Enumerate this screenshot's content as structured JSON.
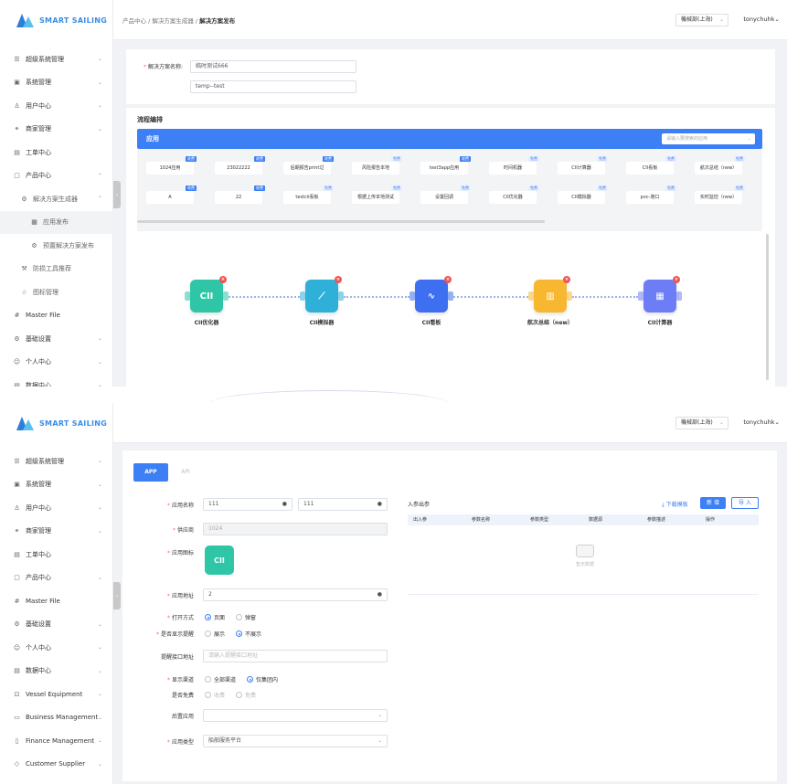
{
  "brand": {
    "logo_text": "SMART SAILING"
  },
  "shot1": {
    "breadcrumb": {
      "part1": "产品中心",
      "part2": "解决方案生成器",
      "current": "解决方案发布"
    },
    "header": {
      "dept": "機械部(上海)",
      "user": "tonychuhk"
    },
    "menu": [
      {
        "label": "超级系统管理",
        "icon": "list-icon",
        "chev": "⌄"
      },
      {
        "label": "系统管理",
        "icon": "monitor-icon",
        "chev": "⌄"
      },
      {
        "label": "用户中心",
        "icon": "user-icon",
        "chev": "⌄"
      },
      {
        "label": "商家管理",
        "icon": "handshake-icon",
        "chev": "⌄"
      },
      {
        "label": "工单中心",
        "icon": "ticket-icon",
        "chev": ""
      },
      {
        "label": "产品中心",
        "icon": "box-icon",
        "chev": "⌃"
      },
      {
        "label": "解决方案生成器",
        "icon": "gear-icon",
        "chev": "⌃",
        "level": 1
      },
      {
        "label": "应用发布",
        "icon": "grid-icon",
        "chev": "",
        "level": 2,
        "active": true
      },
      {
        "label": "预置解决方案发布",
        "icon": "gear-icon",
        "chev": "",
        "level": 2
      },
      {
        "label": "防损工具推荐",
        "icon": "tool-icon",
        "chev": "",
        "level": 1
      },
      {
        "label": "图标管理",
        "icon": "star-icon",
        "chev": "",
        "level": 1
      },
      {
        "label": "Master File",
        "icon": "hash-icon",
        "chev": ""
      },
      {
        "label": "基础设置",
        "icon": "settings-icon",
        "chev": "⌄"
      },
      {
        "label": "个人中心",
        "icon": "person-icon",
        "chev": "⌄"
      },
      {
        "label": "数据中心",
        "icon": "database-icon",
        "chev": "⌄"
      }
    ],
    "form": {
      "solution_label": "解决方案名称:",
      "solution_name": "临时测试666",
      "solution_code": "temp--test"
    },
    "flow_title": "流程编排",
    "apps_bar": {
      "title": "应用",
      "search_placeholder": "请输入要搜索的应用"
    },
    "app_row1": [
      {
        "name": "1024应用",
        "tag": "收费"
      },
      {
        "name": "23022222",
        "tag": "收费"
      },
      {
        "name": "后期报告print过",
        "tag": "收费"
      },
      {
        "name": "风险报告本地",
        "tag": "免费"
      },
      {
        "name": "test3app应用",
        "tag": "收费"
      },
      {
        "name": "时间机器",
        "tag": "免费"
      },
      {
        "name": "CII计算器",
        "tag": "免费"
      },
      {
        "name": "CII看板",
        "tag": "免费"
      },
      {
        "name": "航次总结（new）",
        "tag": "免费"
      }
    ],
    "app_row2": [
      {
        "name": "A",
        "tag": "收费"
      },
      {
        "name": "22",
        "tag": "收费"
      },
      {
        "name": "testcii看板",
        "tag": "免费"
      },
      {
        "name": "根据上传本地测试",
        "tag": "免费"
      },
      {
        "name": "设置回调",
        "tag": "免费"
      },
      {
        "name": "CII优化器",
        "tag": "免费"
      },
      {
        "name": "CII模拟器",
        "tag": "免费"
      },
      {
        "name": "pvc-港口",
        "tag": "免费"
      },
      {
        "name": "实时监控（new）",
        "tag": "免费"
      }
    ],
    "flow_nodes": [
      {
        "caption": "CII优化器",
        "glyph": "CII",
        "color": "#2fc6a8"
      },
      {
        "caption": "CII模拟器",
        "glyph": "⟋",
        "color": "#2fb0d9"
      },
      {
        "caption": "CII看板",
        "glyph": "∿",
        "color": "#3d6ff0"
      },
      {
        "caption": "航次总结（new）",
        "glyph": "▥",
        "color": "#f7b731"
      },
      {
        "caption": "CII计算器",
        "glyph": "▦",
        "color": "#6c7df5"
      }
    ]
  },
  "shot2": {
    "header": {
      "dept": "機械部(上海)",
      "user": "tonychuhk"
    },
    "menu": [
      {
        "label": "超级系统管理",
        "icon": "list-icon",
        "chev": "⌄"
      },
      {
        "label": "系统管理",
        "icon": "monitor-icon",
        "chev": "⌄"
      },
      {
        "label": "用户中心",
        "icon": "user-icon",
        "chev": "⌄"
      },
      {
        "label": "商家管理",
        "icon": "handshake-icon",
        "chev": "⌄"
      },
      {
        "label": "工单中心",
        "icon": "ticket-icon",
        "chev": ""
      },
      {
        "label": "产品中心",
        "icon": "box-icon",
        "chev": "⌄"
      },
      {
        "label": "Master File",
        "icon": "hash-icon",
        "chev": ""
      },
      {
        "label": "基础设置",
        "icon": "settings-icon",
        "chev": "⌄"
      },
      {
        "label": "个人中心",
        "icon": "person-icon",
        "chev": "⌄"
      },
      {
        "label": "数据中心",
        "icon": "database-icon",
        "chev": "⌄"
      },
      {
        "label": "Vessel Equipment",
        "icon": "ship-icon",
        "chev": "⌄"
      },
      {
        "label": "Business Management",
        "icon": "briefcase-icon",
        "chev": "⌄"
      },
      {
        "label": "Finance Management",
        "icon": "wallet-icon",
        "chev": "⌄"
      },
      {
        "label": "Customer Supplier",
        "icon": "contact-icon",
        "chev": "⌄"
      }
    ],
    "tabs": {
      "app": "APP",
      "api": "API"
    },
    "form": {
      "app_name_label": "应用名称",
      "app_name_value": "111",
      "app_name_value2": "111",
      "supplier_label": "供应商",
      "supplier_value": "1024",
      "app_icon_label": "应用图标",
      "icon_glyph": "CII",
      "app_url_label": "应用地址",
      "app_url_value": "2",
      "open_mode_label": "打开方式",
      "open_mode_options": [
        "页面",
        "弹窗"
      ],
      "show_reminder_label": "是否显示提醒",
      "show_reminder_options": [
        "展示",
        "不展示"
      ],
      "reminder_api_label": "提醒接口地址",
      "reminder_api_placeholder": "请输入提醒接口地址",
      "channel_label": "显示渠道",
      "channel_options": [
        "全部渠道",
        "仅集团内"
      ],
      "free_label": "是否免费",
      "free_options": [
        "收费",
        "免费"
      ],
      "backend_label": "后置应用",
      "type_label": "应用类型",
      "type_value": "船舶服务平台"
    },
    "params": {
      "title": "入参出参",
      "download_label": "下载模板",
      "add_label": "新 增",
      "import_label": "导 入",
      "columns": [
        "出入参",
        "参数名称",
        "参数类型",
        "数据源",
        "参数描述",
        "操作"
      ],
      "empty_text": "暂无数据"
    }
  }
}
